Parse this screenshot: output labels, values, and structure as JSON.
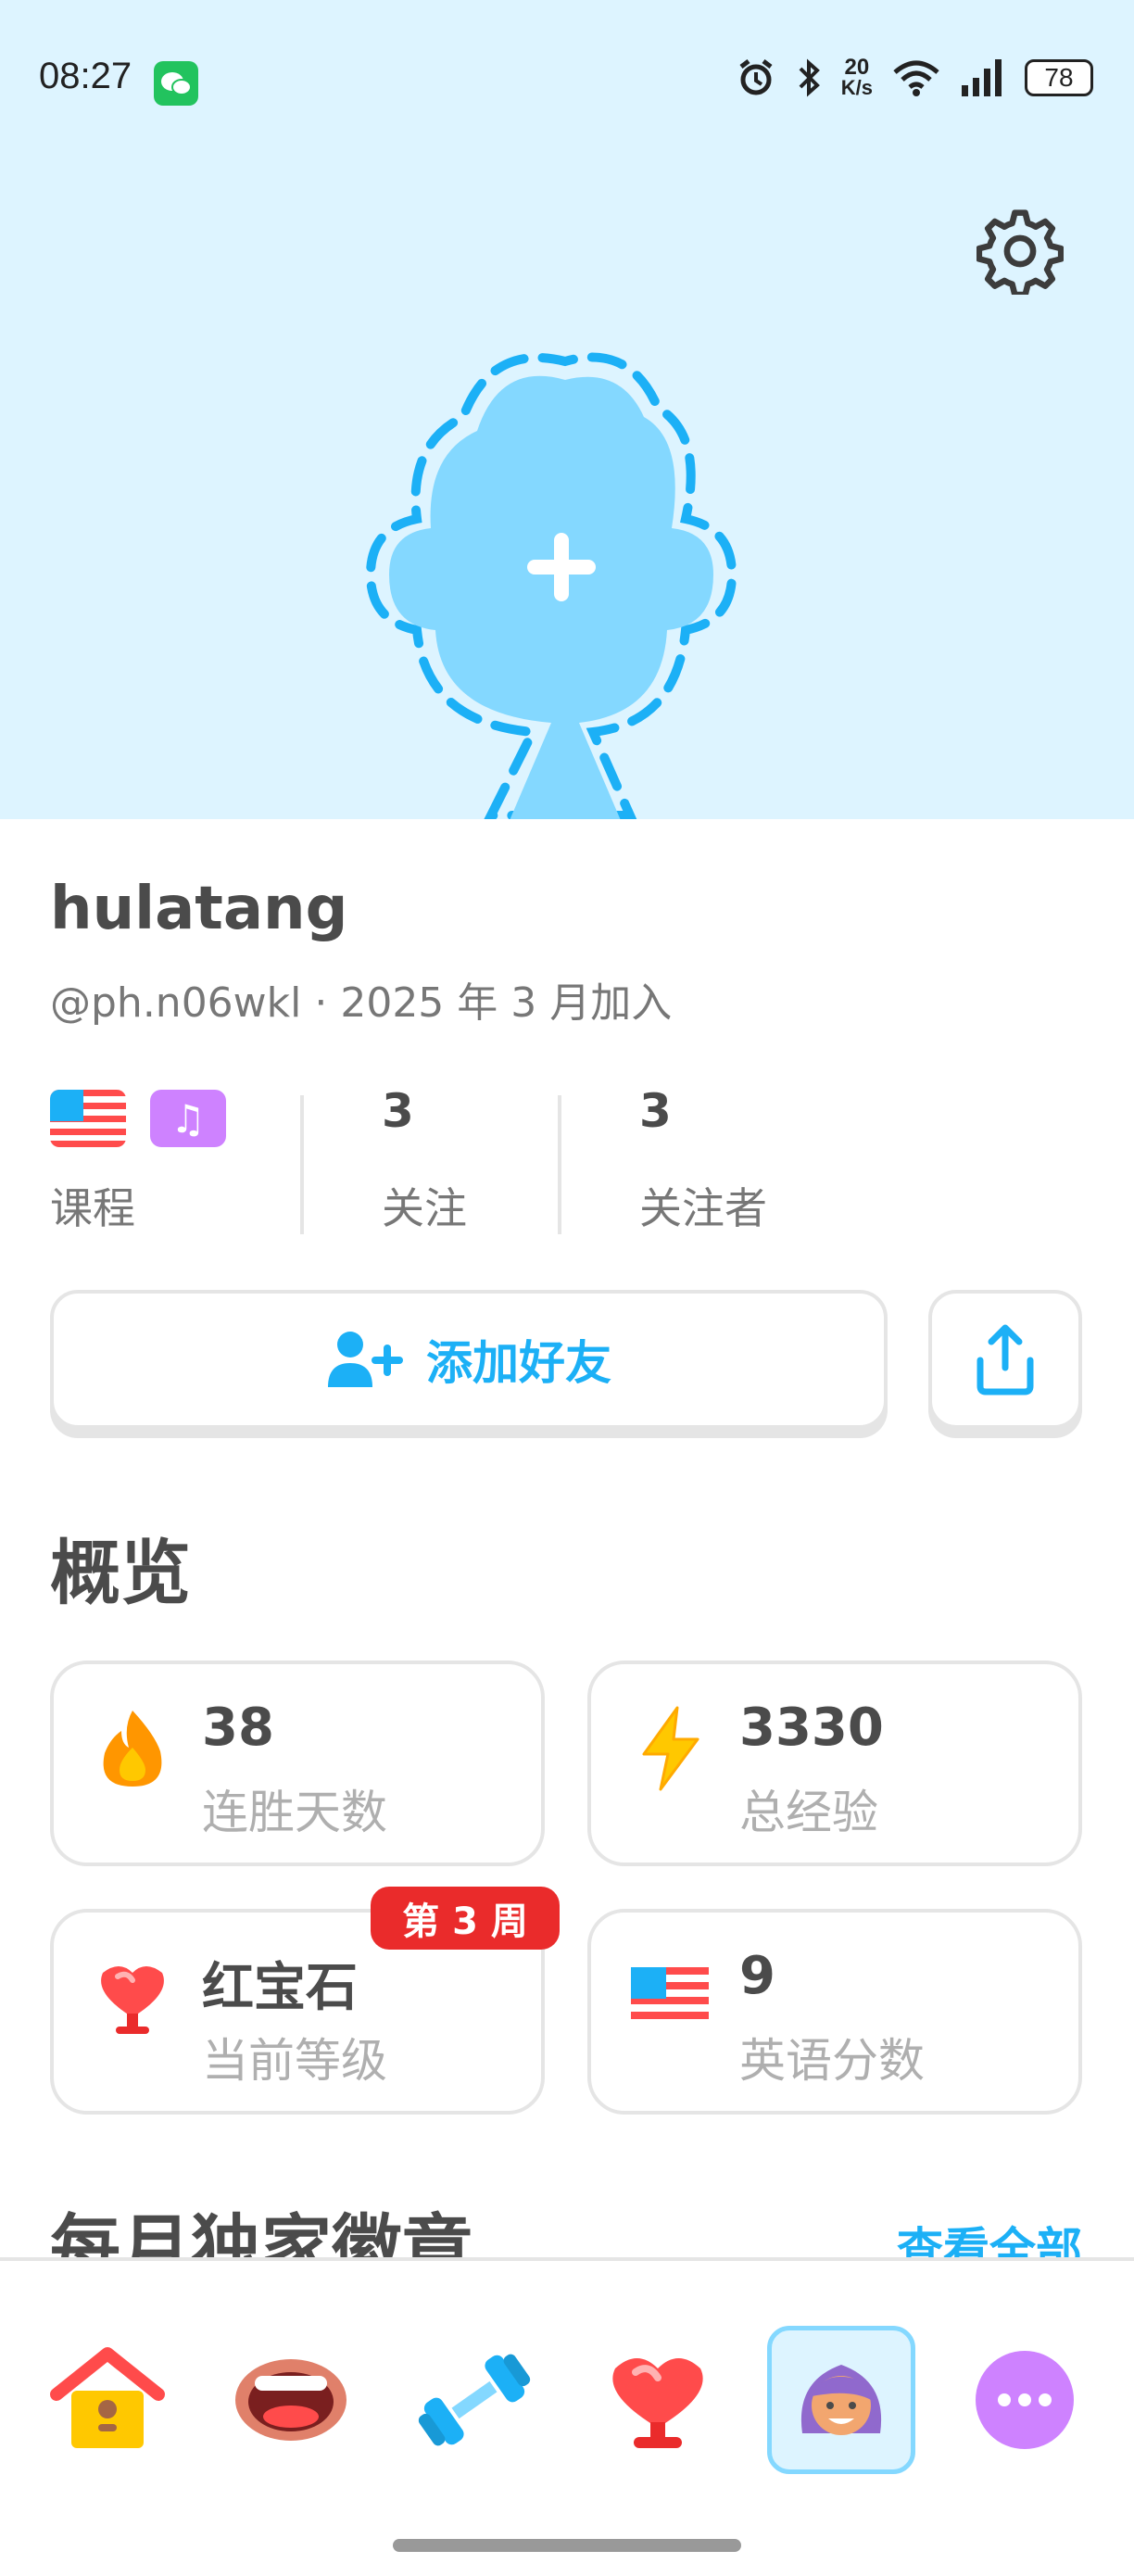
{
  "status_bar": {
    "time": "08:27",
    "net_speed_top": "20",
    "net_speed_unit": "K/s",
    "battery": "78"
  },
  "profile": {
    "name": "hulatang",
    "handle_joined": "@ph.n06wkl · 2025 年 3 月加入",
    "add_avatar_icon": "plus-icon"
  },
  "stats": {
    "courses_label": "课程",
    "following_count": "3",
    "following_label": "关注",
    "followers_count": "3",
    "followers_label": "关注者"
  },
  "actions": {
    "add_friend_label": "添加好友",
    "share_icon": "share-icon"
  },
  "overview": {
    "title": "概览",
    "cards": [
      {
        "value": "38",
        "label": "连胜天数",
        "icon": "flame-icon",
        "color": "#ff9600"
      },
      {
        "value": "3330",
        "label": "总经验",
        "icon": "lightning-icon",
        "color": "#ffc800"
      },
      {
        "value": "红宝石",
        "label": "当前等级",
        "icon": "ruby-trophy-icon",
        "color": "#ff4b4b"
      },
      {
        "value": "9",
        "label": "英语分数",
        "icon": "us-flag-icon",
        "color": "#1cb0f6"
      }
    ],
    "week_badge": "第 3 周"
  },
  "badges": {
    "title": "每月独家徽章",
    "view_all": "查看全部"
  },
  "nav": {
    "items": [
      "home-icon",
      "speak-icon",
      "practice-icon",
      "leaderboard-icon",
      "profile-icon",
      "more-icon"
    ],
    "active": "profile-icon"
  },
  "colors": {
    "hero_bg": "#ddf4ff",
    "accent_blue": "#1cb0f6",
    "text_dark": "#4b4b4b",
    "text_muted": "#777777",
    "border": "#e5e5e5"
  }
}
